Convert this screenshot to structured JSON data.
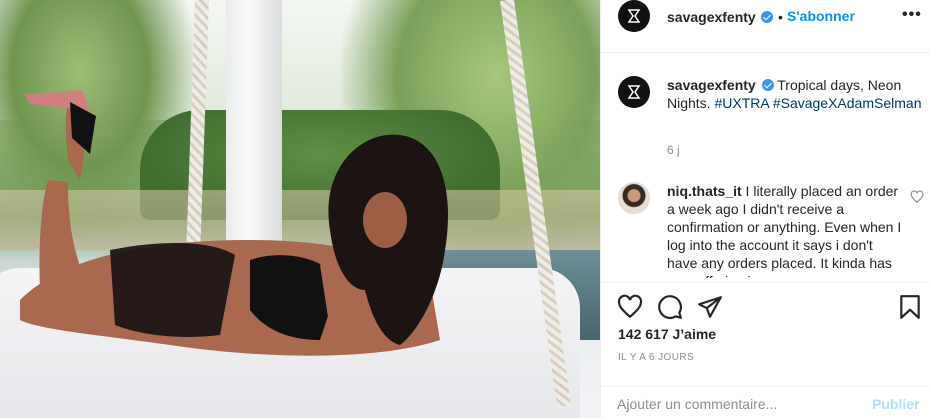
{
  "post": {
    "image_alt": "Tropical photo of a woman lying on a white hanging daybed",
    "image_icon": "photo-image"
  },
  "header": {
    "username": "savagexfenty",
    "dot": "•",
    "follow_label": "S'abonner",
    "more_label": "•••",
    "verified_icon": "verified-badge-icon"
  },
  "caption": {
    "username": "savagexfenty",
    "text": " Tropical days, Neon Nights. ",
    "hashtags": [
      "#UXTRA",
      "#SavageXAdamSelman"
    ],
    "time": "6 j"
  },
  "comment": {
    "username": "niq.thats_it",
    "text": " I literally placed an order a week ago I didn't receive a confirmation or anything. Even when I log into the account it says i don't have any orders placed. It kinda has me suffering in a way"
  },
  "actions": {
    "like_icon": "heart-icon",
    "comment_icon": "comment-icon",
    "share_icon": "share-icon",
    "save_icon": "bookmark-icon"
  },
  "likes": "142 617 J’aime",
  "date": "IL Y A 6 JOURS",
  "add_comment": {
    "placeholder": "Ajouter un commentaire...",
    "publish_label": "Publier"
  },
  "colors": {
    "link_blue": "#0095f6",
    "hashtag": "#00376b",
    "verified": "#3897f0",
    "muted": "#8e8e8e",
    "publish_disabled": "#b2dffc"
  }
}
